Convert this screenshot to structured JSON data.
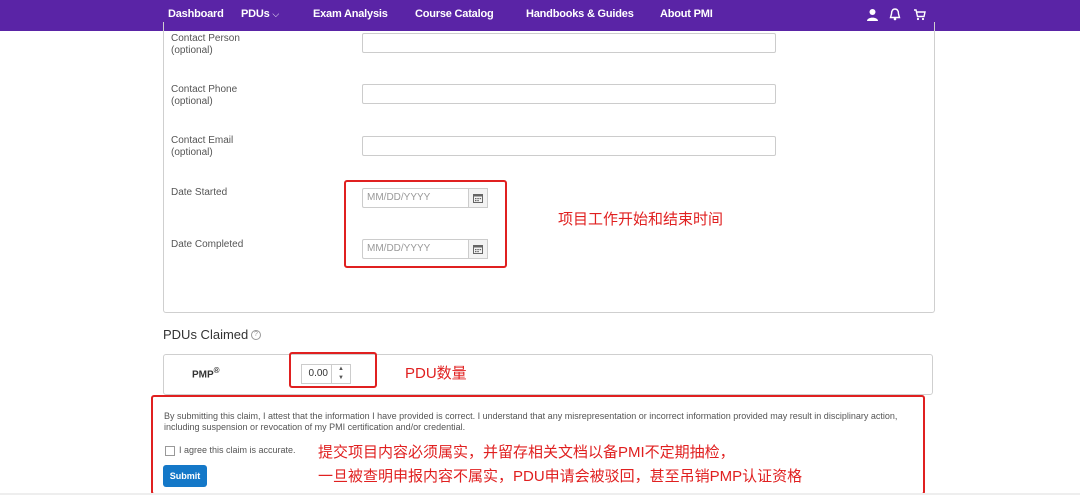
{
  "nav": {
    "items": [
      "Dashboard",
      "PDUs",
      "Exam Analysis",
      "Course Catalog",
      "Handbooks & Guides",
      "About PMI"
    ],
    "pdus_caret": "⌵",
    "icons": [
      "user-icon",
      "bell-icon",
      "cart-icon"
    ],
    "bg_color": "#5a24a6"
  },
  "form": {
    "contact_person": {
      "label": "Contact Person",
      "sub": "(optional)"
    },
    "contact_phone": {
      "label": "Contact Phone",
      "sub": "(optional)"
    },
    "contact_email": {
      "label": "Contact Email",
      "sub": "(optional)"
    },
    "date_started": {
      "label": "Date Started",
      "placeholder": "MM/DD/YYYY"
    },
    "date_completed": {
      "label": "Date Completed",
      "placeholder": "MM/DD/YYYY"
    }
  },
  "pdus": {
    "title": "PDUs Claimed",
    "help": "?",
    "pmp_label": "PMP",
    "pmp_sup": "®",
    "value": "0.00"
  },
  "attest": {
    "text": "By submitting this claim, I attest that the information I have provided is correct. I understand that any misrepresentation or incorrect information provided may result in disciplinary action, including suspension or revocation of my PMI certification and/or credential.",
    "checkbox_label": "I agree this claim is accurate.",
    "submit": "Submit"
  },
  "annotations": {
    "dates": "项目工作开始和结束时间",
    "pdu": "PDU数量",
    "attest_line1": "提交项目内容必须属实，并留存相关文档以备PMI不定期抽检，",
    "attest_line2": "一旦被查明申报内容不属实，PDU申请会被驳回，甚至吊销PMP认证资格",
    "color": "#e02020"
  }
}
